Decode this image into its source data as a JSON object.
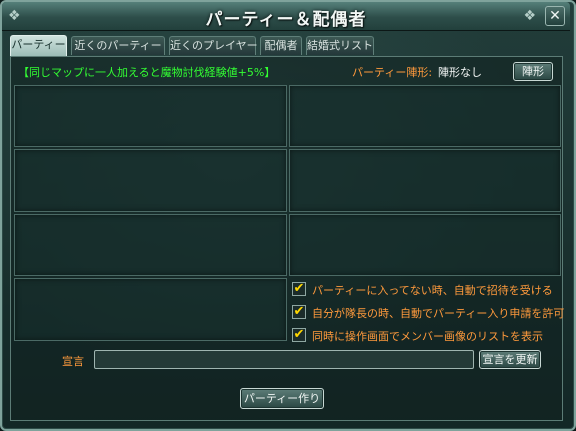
{
  "window": {
    "title": "パーティー＆配偶者",
    "close_label": "✕"
  },
  "tabs": [
    {
      "label": "パーティー",
      "active": true
    },
    {
      "label": "近くのパーティー",
      "active": false
    },
    {
      "label": "近くのプレイヤー",
      "active": false
    },
    {
      "label": "配偶者",
      "active": false
    },
    {
      "label": "結婚式リスト",
      "active": false
    }
  ],
  "party": {
    "notice": "【同じマップに一人加えると魔物討伐経験値+5%】",
    "formation_label": "パーティー陣形:",
    "formation_value": "陣形なし",
    "formation_button": "陣形"
  },
  "options": [
    {
      "label": "パーティーに入ってない時、自動で招待を受ける",
      "checked": true
    },
    {
      "label": "自分が隊長の時、自動でパーティー入り申請を許可",
      "checked": true
    },
    {
      "label": "同時に操作画面でメンバー画像のリストを表示",
      "checked": true
    }
  ],
  "declaration": {
    "label": "宣言",
    "value": "",
    "update_button": "宣言を更新"
  },
  "create_button": "パーティー作り",
  "colors": {
    "accent_orange": "#ff9a3c",
    "notice_green": "#33ff33",
    "check_yellow": "#ffd700"
  }
}
